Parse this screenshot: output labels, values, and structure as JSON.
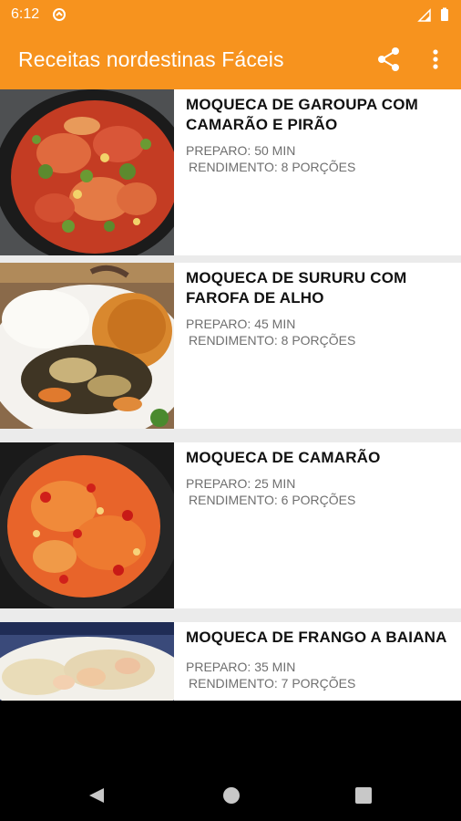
{
  "status_bar": {
    "time": "6:12"
  },
  "app_bar": {
    "title": "Receitas nordestinas Fáceis",
    "share_icon": "share-icon",
    "more_icon": "more-vert-icon"
  },
  "recipes": [
    {
      "title": "MOQUECA DE GAROUPA COM CAMARÃO E PIRÃO",
      "prep": "PREPARO: 50 MIN",
      "yield": "RENDIMENTO: 8 PORÇÕES"
    },
    {
      "title": "MOQUECA DE SURURU COM FAROFA DE ALHO",
      "prep": "PREPARO: 45 MIN",
      "yield": "RENDIMENTO: 8 PORÇÕES"
    },
    {
      "title": "MOQUECA DE CAMARÃO",
      "prep": "PREPARO: 25 MIN",
      "yield": "RENDIMENTO: 6 PORÇÕES"
    },
    {
      "title": "MOQUECA DE FRANGO A BAIANA",
      "prep": "PREPARO: 35 MIN",
      "yield": "RENDIMENTO: 7 PORÇÕES"
    }
  ],
  "colors": {
    "accent": "#f7931e",
    "list_bg": "#ebebeb",
    "meta_text": "#6f6f6f"
  },
  "nav_bar": {
    "back_icon": "back-icon",
    "home_icon": "home-icon",
    "recents_icon": "recents-icon"
  }
}
